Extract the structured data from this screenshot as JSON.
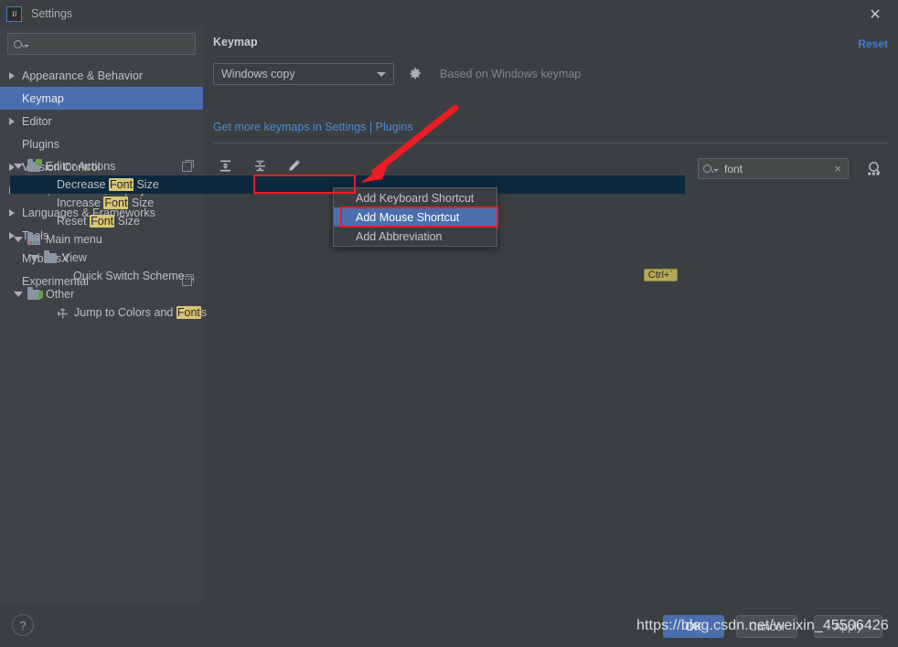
{
  "window": {
    "title": "Settings",
    "logo_text": "IJ",
    "close_icon": "✕"
  },
  "sidebar": {
    "search_placeholder": "",
    "search_value": "",
    "items": [
      {
        "label": "Appearance & Behavior",
        "expandable": true,
        "selected": false,
        "copy_icon": false
      },
      {
        "label": "Keymap",
        "expandable": false,
        "selected": true,
        "copy_icon": false
      },
      {
        "label": "Editor",
        "expandable": true,
        "selected": false,
        "copy_icon": false
      },
      {
        "label": "Plugins",
        "expandable": false,
        "selected": false,
        "copy_icon": false
      },
      {
        "label": "Version Control",
        "expandable": true,
        "selected": false,
        "copy_icon": true
      },
      {
        "label": "Build, Execution, Deployment",
        "expandable": true,
        "selected": false,
        "copy_icon": false
      },
      {
        "label": "Languages & Frameworks",
        "expandable": true,
        "selected": false,
        "copy_icon": false
      },
      {
        "label": "Tools",
        "expandable": true,
        "selected": false,
        "copy_icon": false
      },
      {
        "label": "MybatisX",
        "expandable": false,
        "selected": false,
        "copy_icon": false
      },
      {
        "label": "Experimental",
        "expandable": false,
        "selected": false,
        "copy_icon": true
      }
    ]
  },
  "main": {
    "title": "Keymap",
    "reset_label": "Reset",
    "keymap_select_value": "Windows copy",
    "based_on_text": "Based on Windows keymap",
    "plugins_link": "Get more keymaps in Settings | Plugins",
    "toolbar": {
      "expand_all": "expand-all-icon",
      "collapse_all": "collapse-all-icon",
      "edit": "edit-pencil-icon"
    },
    "filter_search_value": "font",
    "filter_clear_icon": "×",
    "find_icon": "find-shortcut-icon"
  },
  "tree": {
    "rows": [
      {
        "id": "editor-actions",
        "label": "Editor Actions",
        "indent": 0,
        "expander": true,
        "icon": "folder-green",
        "selected": false,
        "segments": [
          {
            "t": "Editor Actions",
            "h": false
          }
        ]
      },
      {
        "id": "decrease-font-size",
        "label": "Decrease Font Size",
        "indent": 2,
        "expander": false,
        "icon": "none",
        "selected": true,
        "segments": [
          {
            "t": "Decrease ",
            "h": false
          },
          {
            "t": "Font",
            "h": true
          },
          {
            "t": " Size",
            "h": false
          }
        ]
      },
      {
        "id": "increase-font-size",
        "label": "Increase Font Size",
        "indent": 2,
        "expander": false,
        "icon": "none",
        "selected": false,
        "segments": [
          {
            "t": "Increase ",
            "h": false
          },
          {
            "t": "Font",
            "h": true
          },
          {
            "t": " Size",
            "h": false
          }
        ]
      },
      {
        "id": "reset-font-size",
        "label": "Reset Font Size",
        "indent": 2,
        "expander": false,
        "icon": "none",
        "selected": false,
        "segments": [
          {
            "t": "Reset ",
            "h": false
          },
          {
            "t": "Font",
            "h": true
          },
          {
            "t": " Size",
            "h": false
          }
        ]
      },
      {
        "id": "main-menu",
        "label": "Main menu",
        "indent": 0,
        "expander": true,
        "icon": "folder-dots",
        "selected": false,
        "segments": [
          {
            "t": "Main menu",
            "h": false
          }
        ]
      },
      {
        "id": "view",
        "label": "View",
        "indent": 1,
        "expander": true,
        "icon": "folder-plain",
        "selected": false,
        "segments": [
          {
            "t": "View",
            "h": false
          }
        ]
      },
      {
        "id": "quick-switch-scheme",
        "label": "Quick Switch Scheme...",
        "indent": 3,
        "expander": false,
        "icon": "none",
        "selected": false,
        "shortcut": "Ctrl+`",
        "segments": [
          {
            "t": "Quick Switch Scheme...",
            "h": false
          }
        ]
      },
      {
        "id": "other",
        "label": "Other",
        "indent": 0,
        "expander": true,
        "icon": "folder-multi",
        "selected": false,
        "segments": [
          {
            "t": "Other",
            "h": false
          }
        ]
      },
      {
        "id": "jump-to-colors-and-fonts",
        "label": "Jump to Colors and Fonts",
        "indent": 2,
        "expander": false,
        "icon": "wrench",
        "selected": false,
        "segments": [
          {
            "t": "Jump to Colors and ",
            "h": false
          },
          {
            "t": "Font",
            "h": true
          },
          {
            "t": "s",
            "h": false
          }
        ]
      }
    ]
  },
  "context_menu": {
    "items": [
      {
        "label": "Add Keyboard Shortcut",
        "highlighted": false
      },
      {
        "label": "Add Mouse Shortcut",
        "highlighted": true
      },
      {
        "label": "Add Abbreviation",
        "highlighted": false
      }
    ]
  },
  "footer": {
    "help_label": "?",
    "ok_label": "OK",
    "cancel_label": "Cancel",
    "apply_label": "Apply"
  },
  "annotations": {
    "watermark": "https://blog.csdn.net/weixin_45506426",
    "arrow_color": "#ec1c24",
    "box_color": "#ec1c24"
  },
  "colors": {
    "window_bg": "#3c3f41",
    "sidebar_bg": "#3f4246",
    "selection_blue": "#4b6eaf",
    "link_blue": "#4a8ad4",
    "tree_selected": "#0d293e",
    "highlight_yellow": "#d9c472",
    "shortcut_badge": "#b5aa53"
  }
}
